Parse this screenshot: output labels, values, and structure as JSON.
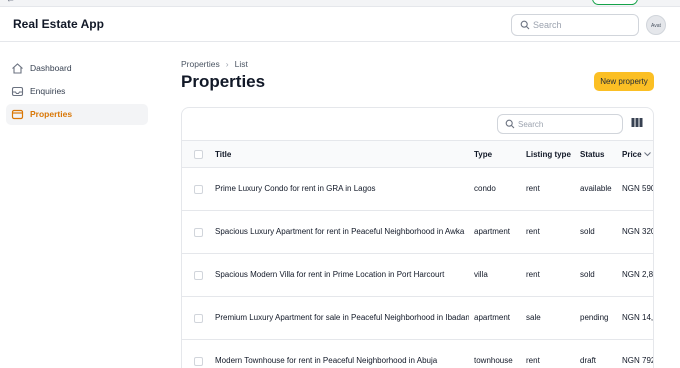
{
  "app": {
    "title": "Real Estate App"
  },
  "header": {
    "search_placeholder": "Search",
    "avatar_alt": "Avat"
  },
  "sidebar": {
    "items": [
      {
        "label": "Dashboard",
        "icon": "home-icon",
        "active": false
      },
      {
        "label": "Enquiries",
        "icon": "inbox-icon",
        "active": false
      },
      {
        "label": "Properties",
        "icon": "folder-icon",
        "active": true
      }
    ]
  },
  "breadcrumb": {
    "parent": "Properties",
    "current": "List"
  },
  "page": {
    "title": "Properties",
    "new_button": "New property"
  },
  "table": {
    "search_placeholder": "Search",
    "columns": {
      "title": "Title",
      "type": "Type",
      "listing_type": "Listing type",
      "status": "Status",
      "price": "Price"
    },
    "rows": [
      {
        "title": "Prime Luxury Condo for rent in GRA in Lagos",
        "type": "condo",
        "listing_type": "rent",
        "status": "available",
        "price": "NGN 590,"
      },
      {
        "title": "Spacious Luxury Apartment for rent in Peaceful Neighborhood in Awka",
        "type": "apartment",
        "listing_type": "rent",
        "status": "sold",
        "price": "NGN 320"
      },
      {
        "title": "Spacious Modern Villa for rent in Prime Location in Port Harcourt",
        "type": "villa",
        "listing_type": "rent",
        "status": "sold",
        "price": "NGN 2,82"
      },
      {
        "title": "Premium Luxury Apartment for sale in Peaceful Neighborhood in Ibadan",
        "type": "apartment",
        "listing_type": "sale",
        "status": "pending",
        "price": "NGN 14,0"
      },
      {
        "title": "Modern Townhouse for rent in Peaceful Neighborhood in Abuja",
        "type": "townhouse",
        "listing_type": "rent",
        "status": "draft",
        "price": "NGN 792,"
      }
    ]
  },
  "colors": {
    "accent": "#fbbf24",
    "active_nav": "#d97706"
  }
}
